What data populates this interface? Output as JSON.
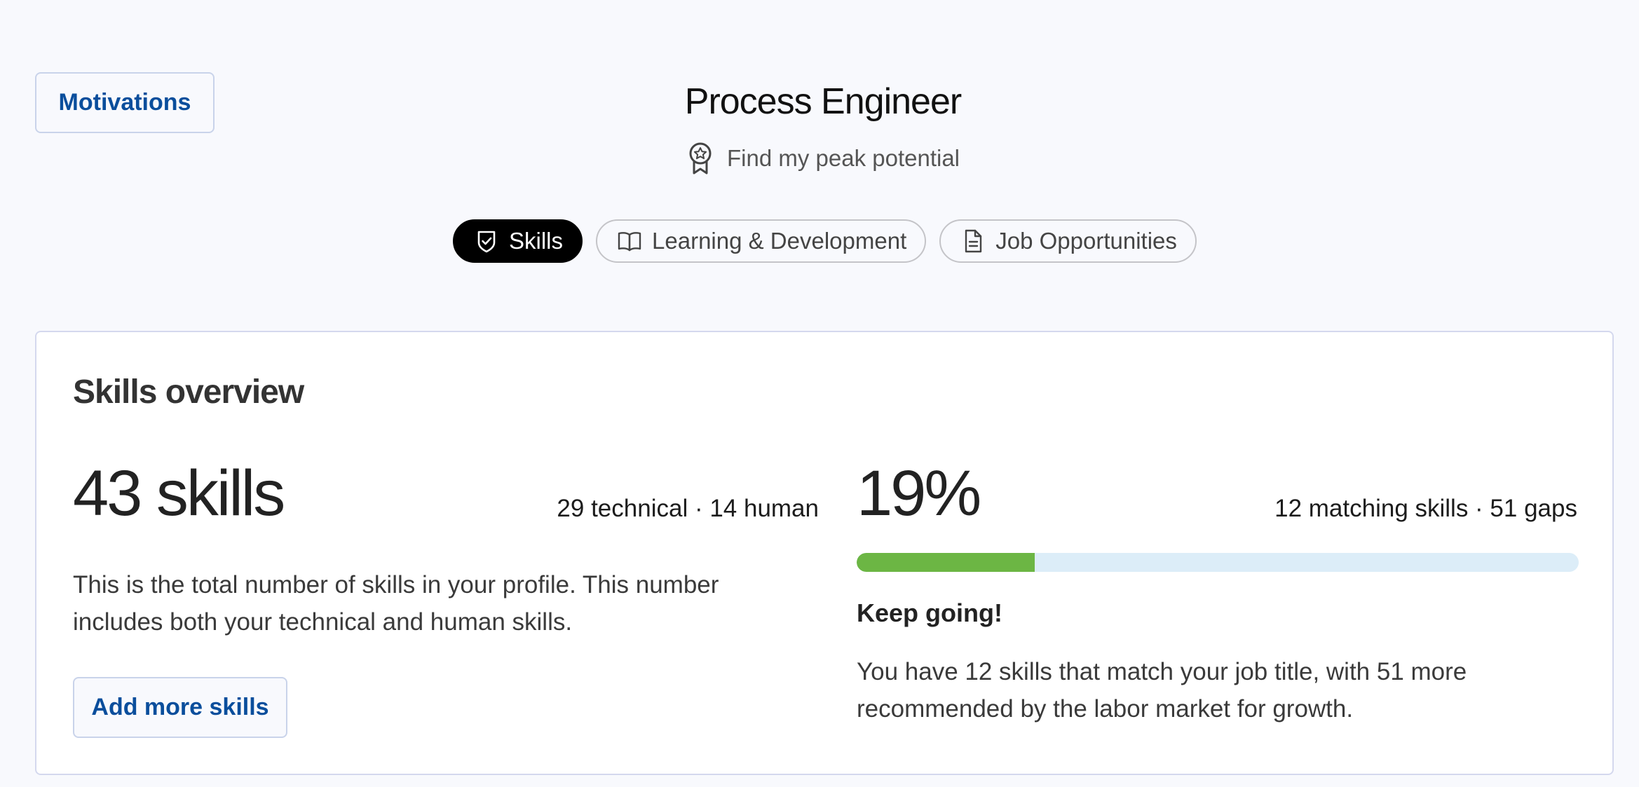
{
  "motivations_label": "Motivations",
  "page_title": "Process Engineer",
  "goal_text": "Find my peak potential",
  "tabs": [
    {
      "label": "Skills",
      "icon": "shield-check-icon",
      "active": true
    },
    {
      "label": "Learning & Development",
      "icon": "book-open-icon",
      "active": false
    },
    {
      "label": "Job Opportunities",
      "icon": "document-icon",
      "active": false
    }
  ],
  "overview": {
    "title": "Skills overview",
    "total": {
      "value": "43 skills",
      "breakdown": "29 technical · 14 human",
      "description": "This is the total number of skills in your profile. This number includes both your technical and human skills.",
      "add_button": "Add more skills"
    },
    "match": {
      "percent_label": "19%",
      "progress": 0.19,
      "summary": "12 matching skills · 51 gaps",
      "heading": "Keep going!",
      "description": "You have 12 skills that match your job title, with 51 more recommended by the labor market for growth."
    }
  },
  "colors": {
    "accent": "#0a4e9c",
    "progress_fill": "#6cb644",
    "progress_track": "#dcedf8",
    "active_tab": "#000000"
  }
}
